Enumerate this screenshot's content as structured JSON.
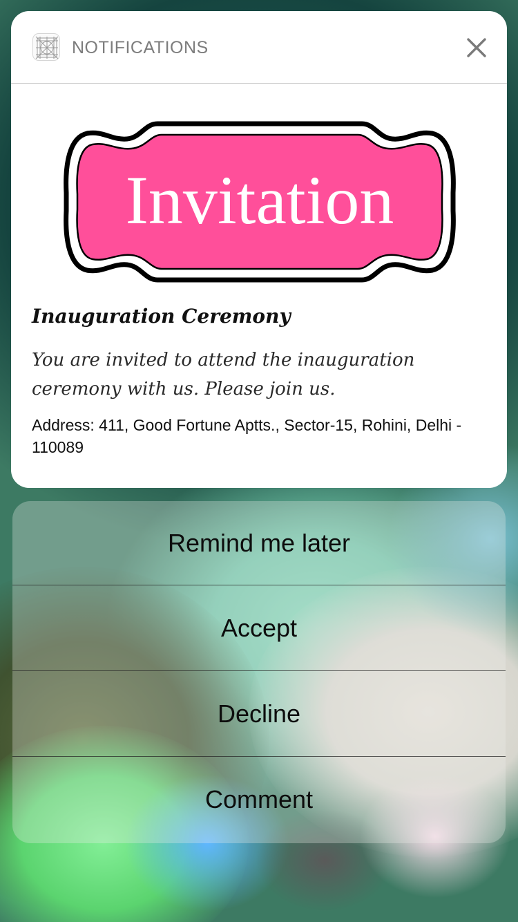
{
  "notification": {
    "app_name": "NOTIFICATIONS",
    "app_icon": "app-grid-icon",
    "close_icon": "close-icon",
    "graphic": {
      "label": "Invitation",
      "fill_color": "#ff4f9a",
      "outline_color": "#000000"
    },
    "title": "Inauguration Ceremony",
    "message": "You are invited to attend the inauguration ceremony with us. Please join us.",
    "address": "Address: 411, Good Fortune Aptts., Sector-15, Rohini, Delhi - 110089"
  },
  "actions": [
    {
      "label": "Remind me later"
    },
    {
      "label": "Accept"
    },
    {
      "label": "Decline"
    },
    {
      "label": "Comment"
    }
  ]
}
